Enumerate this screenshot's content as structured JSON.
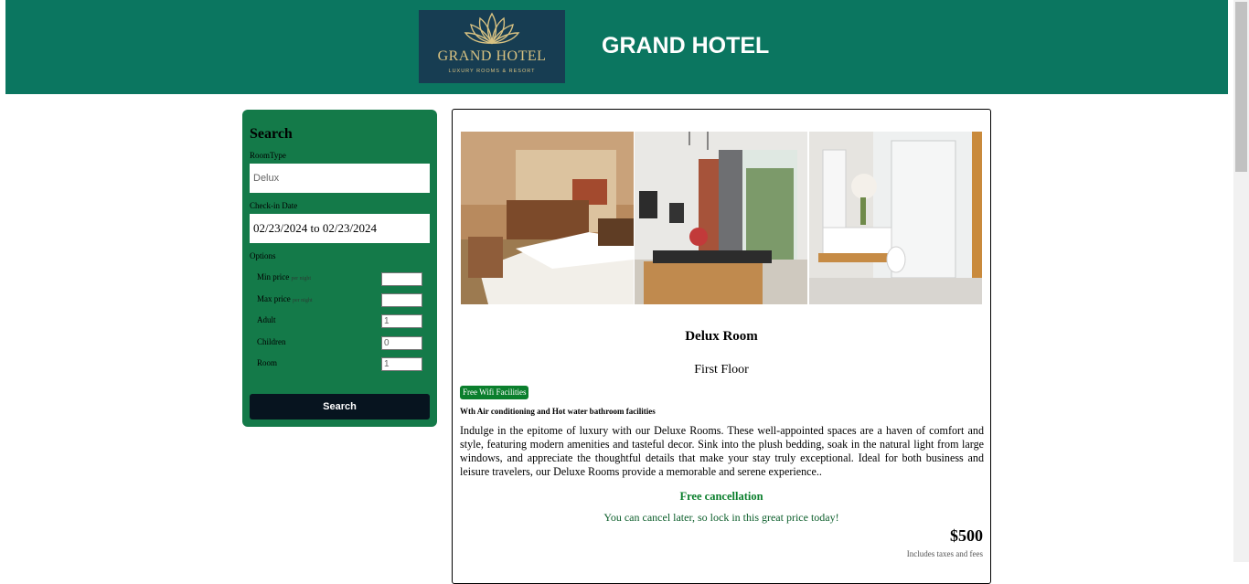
{
  "header": {
    "logo_name": "GRAND HOTEL",
    "logo_tagline": "LUXURY ROOMS & RESORT",
    "title": "GRAND HOTEL",
    "background_color": "#0b7660"
  },
  "search": {
    "title": "Search",
    "room_type_label": "RoomType",
    "room_type_value": "Delux",
    "checkin_label": "Check-in Date",
    "checkin_value": "02/23/2024 to 02/23/2024",
    "options_label": "Options",
    "options": [
      {
        "label": "Min price",
        "note": "per night",
        "value": ""
      },
      {
        "label": "Max price",
        "note": "per night",
        "value": ""
      },
      {
        "label": "Adult",
        "note": "",
        "value": "1"
      },
      {
        "label": "Children",
        "note": "",
        "value": "0"
      },
      {
        "label": "Room",
        "note": "",
        "value": "1"
      }
    ],
    "button_label": "Search",
    "panel_color": "#147a49"
  },
  "room": {
    "photos": [
      "bedroom-photo",
      "dining-room-photo",
      "bathroom-photo"
    ],
    "title": "Delux Room",
    "floor": "First Floor",
    "badge": "Free Wifi Facilities",
    "facilities": "Wth Air conditioning and Hot water bathroom facilities",
    "description": "Indulge in the epitome of luxury with our Deluxe Rooms. These well-appointed spaces are a haven of comfort and style, featuring modern amenities and tasteful decor. Sink into the plush bedding, soak in the natural light from large windows, and appreciate the thoughtful details that make your stay truly exceptional. Ideal for both business and leisure travelers, our Deluxe Rooms provide a memorable and serene experience..",
    "cancel_title": "Free cancellation",
    "cancel_text": "You can cancel later, so lock in this great price today!",
    "price": "$500",
    "tax_note": "Includes taxes and fees"
  }
}
